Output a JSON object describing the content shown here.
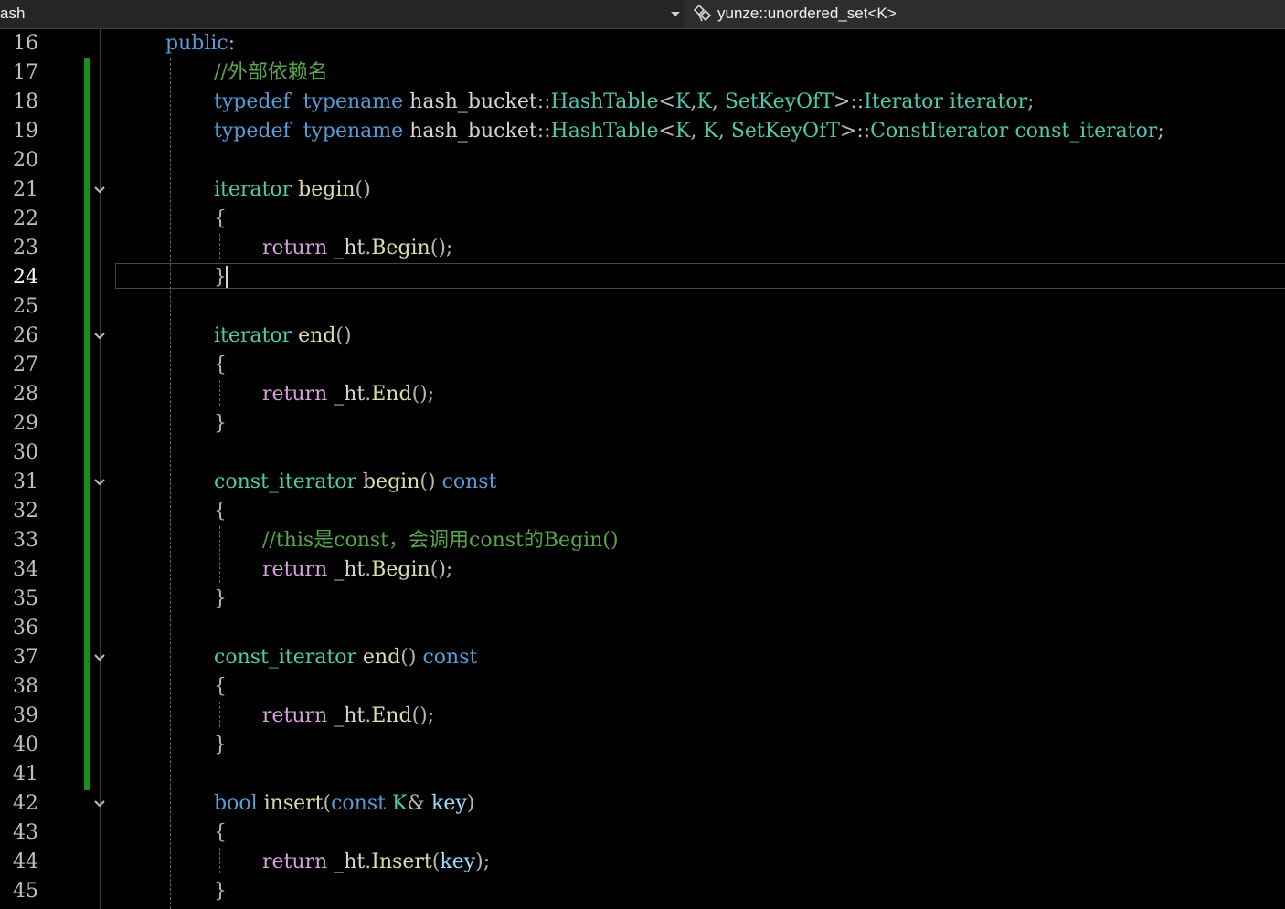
{
  "header": {
    "left_label": "ash",
    "scope_label": "yunze::unordered_set<K>",
    "scope_icon": "class-member-icon"
  },
  "editor": {
    "current_line": 24,
    "change_marker_color": "#1a8c1a",
    "line_numbers": [
      "16",
      "17",
      "18",
      "19",
      "20",
      "21",
      "22",
      "23",
      "24",
      "25",
      "26",
      "27",
      "28",
      "29",
      "30",
      "31",
      "32",
      "33",
      "34",
      "35",
      "36",
      "37",
      "38",
      "39",
      "40",
      "41",
      "42",
      "43",
      "44",
      "45"
    ],
    "folds": [
      "21",
      "26",
      "31",
      "37",
      "42"
    ],
    "lines": {
      "l16": [
        [
          "kw",
          "public"
        ],
        [
          "pn",
          ":"
        ]
      ],
      "l17": [
        [
          "cm",
          "//外部依赖名"
        ]
      ],
      "l18": [
        [
          "kw",
          "typedef"
        ],
        [
          "",
          "  "
        ],
        [
          "kw",
          "typename"
        ],
        [
          "",
          " hash_bucket"
        ],
        [
          "pn",
          "::"
        ],
        [
          "ty",
          "HashTable"
        ],
        [
          "pn",
          "<"
        ],
        [
          "ty",
          "K"
        ],
        [
          "pn",
          ","
        ],
        [
          "",
          "",
          " "
        ],
        [
          "ty",
          "K"
        ],
        [
          "pn",
          ","
        ],
        [
          "",
          " "
        ],
        [
          "ty",
          "SetKeyOfT"
        ],
        [
          "pn",
          ">::"
        ],
        [
          "ty",
          "Iterator"
        ],
        [
          "",
          " "
        ],
        [
          "ty",
          "iterator"
        ],
        [
          "pn",
          ";"
        ]
      ],
      "l19": [
        [
          "kw",
          "typedef"
        ],
        [
          "",
          "  "
        ],
        [
          "kw",
          "typename"
        ],
        [
          "",
          " hash_bucket"
        ],
        [
          "pn",
          "::"
        ],
        [
          "ty",
          "HashTable"
        ],
        [
          "pn",
          "<"
        ],
        [
          "ty",
          "K"
        ],
        [
          "pn",
          ","
        ],
        [
          "",
          " "
        ],
        [
          "ty",
          "K"
        ],
        [
          "pn",
          ","
        ],
        [
          "",
          " "
        ],
        [
          "ty",
          "SetKeyOfT"
        ],
        [
          "pn",
          ">::"
        ],
        [
          "ty",
          "ConstIterator"
        ],
        [
          "",
          " "
        ],
        [
          "ty",
          "const_iterator"
        ],
        [
          "pn",
          ";"
        ]
      ],
      "l21": [
        [
          "ty",
          "iterator"
        ],
        [
          "",
          " "
        ],
        [
          "fn",
          "begin"
        ],
        [
          "pn",
          "()"
        ]
      ],
      "l22": [
        [
          "pn",
          "{"
        ]
      ],
      "l23": [
        [
          "ctl",
          "return"
        ],
        [
          "",
          " _ht"
        ],
        [
          "pn",
          "."
        ],
        [
          "fn",
          "Begin"
        ],
        [
          "pn",
          "();"
        ]
      ],
      "l24": [
        [
          "pn",
          "}"
        ]
      ],
      "l26": [
        [
          "ty",
          "iterator"
        ],
        [
          "",
          " "
        ],
        [
          "fn",
          "end"
        ],
        [
          "pn",
          "()"
        ]
      ],
      "l27": [
        [
          "pn",
          "{"
        ]
      ],
      "l28": [
        [
          "ctl",
          "return"
        ],
        [
          "",
          " _ht"
        ],
        [
          "pn",
          "."
        ],
        [
          "fn",
          "End"
        ],
        [
          "pn",
          "();"
        ]
      ],
      "l29": [
        [
          "pn",
          "}"
        ]
      ],
      "l31": [
        [
          "ty",
          "const_iterator"
        ],
        [
          "",
          " "
        ],
        [
          "fn",
          "begin"
        ],
        [
          "pn",
          "()"
        ],
        [
          "",
          " "
        ],
        [
          "kw",
          "const"
        ]
      ],
      "l32": [
        [
          "pn",
          "{"
        ]
      ],
      "l33": [
        [
          "cm",
          "//this是const，会调用const的Begin()"
        ]
      ],
      "l34": [
        [
          "ctl",
          "return"
        ],
        [
          "",
          " _ht"
        ],
        [
          "pn",
          "."
        ],
        [
          "fn",
          "Begin"
        ],
        [
          "pn",
          "();"
        ]
      ],
      "l35": [
        [
          "pn",
          "}"
        ]
      ],
      "l37": [
        [
          "ty",
          "const_iterator"
        ],
        [
          "",
          " "
        ],
        [
          "fn",
          "end"
        ],
        [
          "pn",
          "()"
        ],
        [
          "",
          " "
        ],
        [
          "kw",
          "const"
        ]
      ],
      "l38": [
        [
          "pn",
          "{"
        ]
      ],
      "l39": [
        [
          "ctl",
          "return"
        ],
        [
          "",
          " _ht"
        ],
        [
          "pn",
          "."
        ],
        [
          "fn",
          "End"
        ],
        [
          "pn",
          "();"
        ]
      ],
      "l40": [
        [
          "pn",
          "}"
        ]
      ],
      "l42": [
        [
          "kw",
          "bool"
        ],
        [
          "",
          " "
        ],
        [
          "fn",
          "insert"
        ],
        [
          "pn",
          "("
        ],
        [
          "kw",
          "const"
        ],
        [
          "",
          " "
        ],
        [
          "ty",
          "K"
        ],
        [
          "pn",
          "&"
        ],
        [
          "",
          " "
        ],
        [
          "pa",
          "key"
        ],
        [
          "pn",
          ")"
        ]
      ],
      "l43": [
        [
          "pn",
          "{"
        ]
      ],
      "l44": [
        [
          "ctl",
          "return"
        ],
        [
          "",
          " _ht"
        ],
        [
          "pn",
          "."
        ],
        [
          "fn",
          "Insert"
        ],
        [
          "pn",
          "("
        ],
        [
          "pa",
          "key"
        ],
        [
          "pn",
          ");"
        ]
      ],
      "l45": [
        [
          "pn",
          "}"
        ]
      ]
    }
  }
}
